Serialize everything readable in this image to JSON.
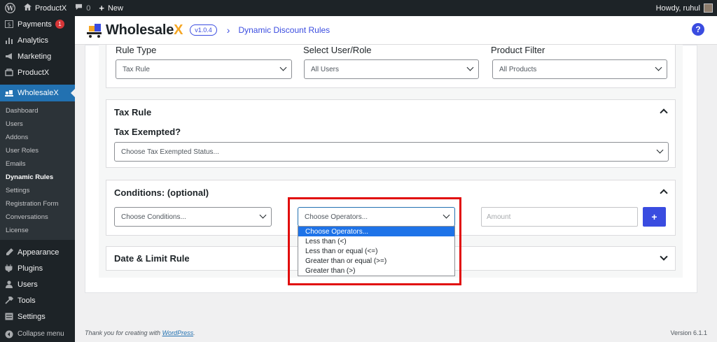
{
  "adminbar": {
    "site_name": "ProductX",
    "comments_count": "0",
    "new_label": "New",
    "howdy": "Howdy, ruhul"
  },
  "sidebar": {
    "items_top": [
      {
        "label": "Payments",
        "icon": "payments-icon",
        "badge": "1"
      },
      {
        "label": "Analytics",
        "icon": "analytics-icon"
      },
      {
        "label": "Marketing",
        "icon": "marketing-icon"
      },
      {
        "label": "ProductX",
        "icon": "productx-icon"
      }
    ],
    "active": {
      "label": "WholesaleX",
      "icon": "wholesalex-icon"
    },
    "submenu": [
      "Dashboard",
      "Users",
      "Addons",
      "User Roles",
      "Emails",
      "Dynamic Rules",
      "Settings",
      "Registration Form",
      "Conversations",
      "License"
    ],
    "current_sub": "Dynamic Rules",
    "items_bottom": [
      {
        "label": "Appearance",
        "icon": "appearance-icon"
      },
      {
        "label": "Plugins",
        "icon": "plugins-icon"
      },
      {
        "label": "Users",
        "icon": "users-icon"
      },
      {
        "label": "Tools",
        "icon": "tools-icon"
      },
      {
        "label": "Settings",
        "icon": "settings-icon"
      },
      {
        "label": "Collapse menu",
        "icon": "collapse-icon"
      }
    ]
  },
  "header": {
    "brand_main": "Wholesale",
    "brand_x": "X",
    "version": "v1.0.4",
    "breadcrumb": "Dynamic Discount Rules",
    "help": "?"
  },
  "rule_settings": {
    "rule_type_label": "Rule Type",
    "rule_type_value": "Tax Rule",
    "user_role_label": "Select User/Role",
    "user_role_value": "All Users",
    "product_filter_label": "Product Filter",
    "product_filter_value": "All Products"
  },
  "tax_rule": {
    "title": "Tax Rule",
    "exempted_label": "Tax Exempted?",
    "exempted_placeholder": "Choose Tax Exempted Status..."
  },
  "conditions": {
    "title": "Conditions: (optional)",
    "conditions_select": "Choose Conditions...",
    "operators_select": "Choose Operators...",
    "amount_placeholder": "Amount",
    "add_button": "+",
    "operator_options": [
      "Choose Operators...",
      "Less than (<)",
      "Less than or equal (<=)",
      "Greater than or equal (>=)",
      "Greater than (>)"
    ]
  },
  "date_limit": {
    "title": "Date & Limit Rule"
  },
  "footer": {
    "thanks_prefix": "Thank you for creating with ",
    "wordpress_link": "WordPress",
    "thanks_suffix": ".",
    "version": "Version 6.1.1"
  }
}
